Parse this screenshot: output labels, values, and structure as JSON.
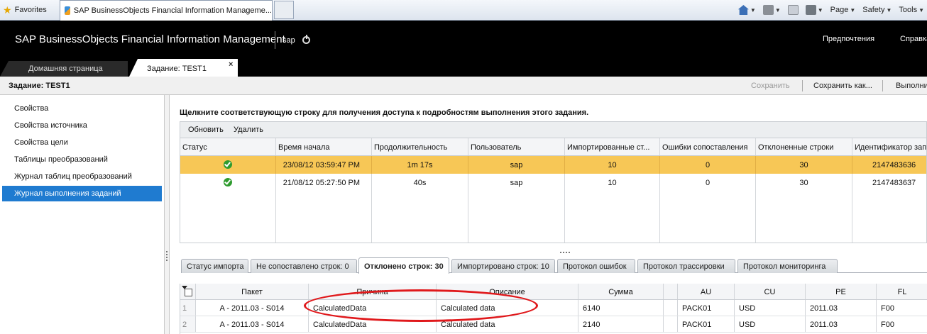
{
  "browser": {
    "favorites_label": "Favorites",
    "tab_title": "SAP BusinessObjects Financial Information Manageme...",
    "toolbar": {
      "page_label": "Page",
      "safety_label": "Safety",
      "tools_label": "Tools"
    }
  },
  "header": {
    "app_title": "SAP BusinessObjects Financial Information Management",
    "user": "sap",
    "preferences_label": "Предпочтения",
    "help_label": "Справка",
    "tabs": [
      {
        "label": "Домашняя страница"
      },
      {
        "label": "Задание: TEST1"
      }
    ]
  },
  "page": {
    "title": "Задание: TEST1",
    "actions": {
      "save": "Сохранить",
      "save_as": "Сохранить как...",
      "run": "Выполнить"
    }
  },
  "sidebar": {
    "items": [
      {
        "label": "Свойства"
      },
      {
        "label": "Свойства источника"
      },
      {
        "label": "Свойства цели"
      },
      {
        "label": "Таблицы преобразований"
      },
      {
        "label": "Журнал таблиц преобразований"
      },
      {
        "label": "Журнал выполнения заданий"
      }
    ],
    "active_index": 5
  },
  "main": {
    "instruction": "Щелкните соответствующую строку для получения доступа к подробностям выполнения этого задания.",
    "toolbar": {
      "refresh": "Обновить",
      "delete": "Удалить"
    },
    "run_grid": {
      "columns": [
        "Статус",
        "Время начала",
        "Продолжительность",
        "Пользователь",
        "Импортированные ст...",
        "Ошибки сопоставления",
        "Отклоненные строки",
        "Идентификатор зап"
      ],
      "rows": [
        {
          "status": "success-icon",
          "start": "23/08/12 03:59:47 PM",
          "duration": "1m 17s",
          "user": "sap",
          "imported": "10",
          "errors": "0",
          "rejected": "30",
          "id": "2147483636",
          "selected": true
        },
        {
          "status": "success-icon",
          "start": "21/08/12 05:27:50 PM",
          "duration": "40s",
          "user": "sap",
          "imported": "10",
          "errors": "0",
          "rejected": "30",
          "id": "2147483637",
          "selected": false
        }
      ]
    },
    "detail_tabs": [
      {
        "label": "Статус импорта"
      },
      {
        "label": "Не сопоставлено строк: 0"
      },
      {
        "label": "Отклонено строк: 30"
      },
      {
        "label": "Импортировано строк: 10"
      },
      {
        "label": "Протокол ошибок"
      },
      {
        "label": "Протокол трассировки"
      },
      {
        "label": "Протокол мониторинга"
      }
    ],
    "active_detail_tab": 2,
    "detail_grid": {
      "columns": [
        "Пакет",
        "Причина",
        "Описание",
        "Сумма",
        "",
        "AU",
        "CU",
        "PE",
        "FL"
      ],
      "rows": [
        {
          "n": "1",
          "packet": "A - 2011.03 - S014",
          "reason": "CalculatedData",
          "desc": "Calculated data",
          "sum": "6140",
          "blank": "",
          "au": "PACK01",
          "cu": "USD",
          "pe": "2011.03",
          "fl": "F00"
        },
        {
          "n": "2",
          "packet": "A - 2011.03 - S014",
          "reason": "CalculatedData",
          "desc": "Calculated data",
          "sum": "2140",
          "blank": "",
          "au": "PACK01",
          "cu": "USD",
          "pe": "2011.03",
          "fl": "F00"
        }
      ]
    }
  },
  "annotation": {
    "color": "#e0191c"
  }
}
